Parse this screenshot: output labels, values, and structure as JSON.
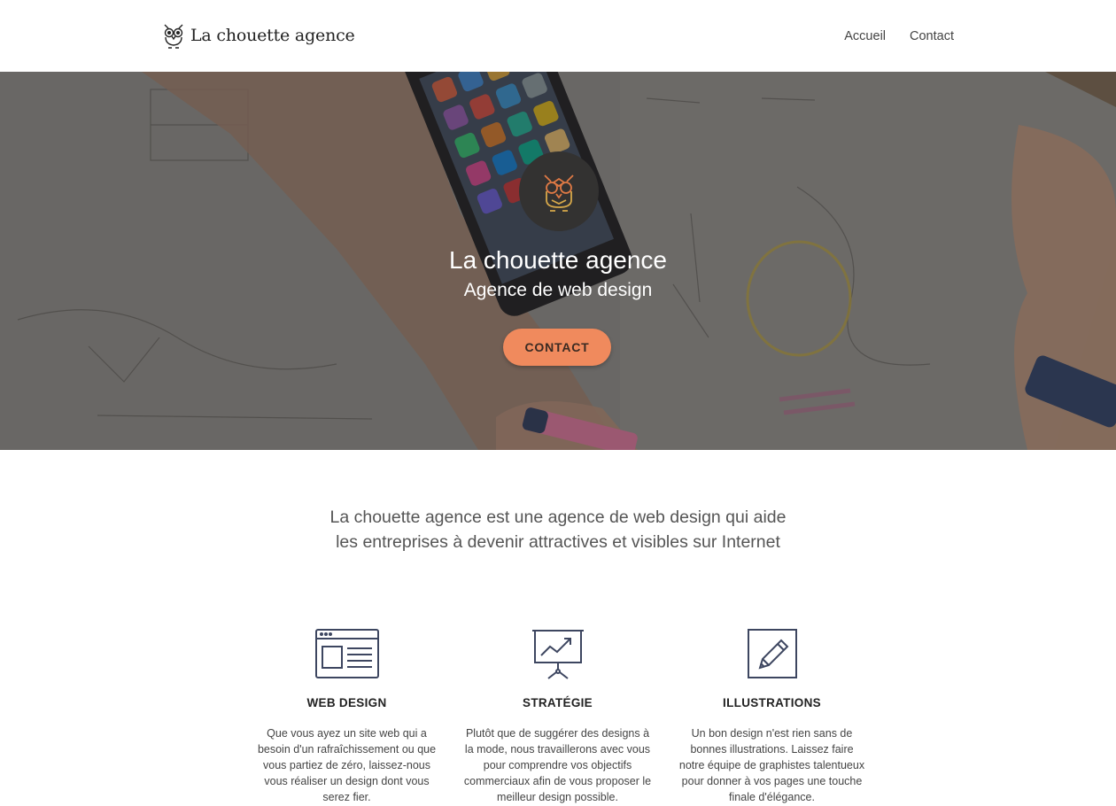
{
  "header": {
    "logo_text": "La chouette agence",
    "nav": [
      {
        "label": "Accueil"
      },
      {
        "label": "Contact"
      }
    ]
  },
  "hero": {
    "title": "La chouette agence",
    "subtitle": "Agence de web design",
    "cta_label": "CONTACT",
    "accent_color": "#f08a5d"
  },
  "intro": {
    "line1": "La chouette agence est une agence de web design qui aide",
    "line2": "les entreprises à devenir attractives et visibles sur Internet"
  },
  "services": [
    {
      "icon": "web-design-icon",
      "title": "WEB DESIGN",
      "lines": [
        "Que vous ayez un site web qui a",
        "besoin d'un rafraîchissement ou que",
        "vous partiez de zéro, laissez-nous",
        "vous réaliser un design dont vous",
        "serez fier."
      ]
    },
    {
      "icon": "strategy-chart-icon",
      "title": "STRATÉGIE",
      "lines": [
        "Plutôt que de suggérer des designs à",
        "la mode, nous travaillerons avec vous",
        "pour comprendre vos objectifs",
        "commerciaux afin de vous proposer le",
        "meilleur design possible."
      ]
    },
    {
      "icon": "pencil-icon",
      "title": "ILLUSTRATIONS",
      "lines": [
        "Un bon design n'est rien sans de",
        "bonnes illustrations. Laissez faire",
        "notre équipe de graphistes talentueux",
        "pour donner à vos pages une touche",
        "finale d'élégance."
      ]
    }
  ]
}
